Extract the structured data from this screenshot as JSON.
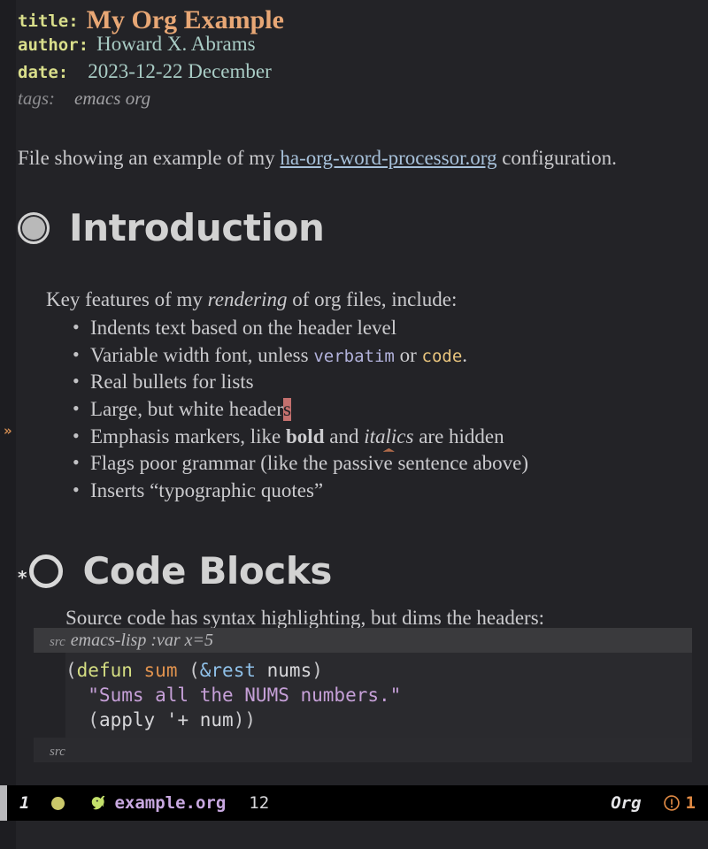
{
  "buffer": {
    "keywords": [
      {
        "key": "title:",
        "value": "My Org Example"
      },
      {
        "key": "author:",
        "value": "Howard X. Abrams"
      },
      {
        "key": "date:",
        "value": "2023-12-22 December"
      },
      {
        "key": "tags:",
        "value": "emacs org"
      }
    ],
    "intro": {
      "before": "File showing an example of my ",
      "link": "ha-org-word-processor.org",
      "after": " configuration."
    },
    "sections": [
      {
        "heading": "Introduction",
        "bullet_icon": "filled-ring-bullet",
        "lead": {
          "before": "Key features of my ",
          "italic": "rendering",
          "after": " of org files, include:"
        },
        "items": [
          {
            "text": "Indents text based on the header level"
          },
          {
            "text": "Variable width font, unless verbatim or code.",
            "parts": [
              {
                "t": "Variable width font, unless ",
                "style": "plain"
              },
              {
                "t": "verbatim",
                "style": "verbatim"
              },
              {
                "t": " or ",
                "style": "plain"
              },
              {
                "t": "code",
                "style": "code"
              },
              {
                "t": ".",
                "style": "plain"
              }
            ]
          },
          {
            "text": "Real bullets for lists"
          },
          {
            "text": "Large, but white headers",
            "parts": [
              {
                "t": "Large, but white header",
                "style": "plain"
              },
              {
                "t": "s",
                "style": "cursor"
              }
            ]
          },
          {
            "text": "Emphasis markers, like bold and italics are hidden",
            "parts": [
              {
                "t": "Emphasis markers, like ",
                "style": "plain"
              },
              {
                "t": "bold",
                "style": "bold"
              },
              {
                "t": " and ",
                "style": "plain"
              },
              {
                "t": "italics",
                "style": "italic-flagged"
              },
              {
                "t": " are hidden",
                "style": "plain"
              }
            ]
          },
          {
            "text": "Flags poor grammar (like the passive sentence above)"
          },
          {
            "text": "Inserts “typographic quotes”"
          }
        ]
      },
      {
        "heading": "Code Blocks",
        "bullet_icon": "hollow-ring-bullet",
        "star": "*",
        "lead": {
          "before": "Source code has syntax highlighting, but dims the headers:",
          "italic": "",
          "after": ""
        },
        "src": {
          "head_kw": "src",
          "head_args": "emacs-lisp :var x=5",
          "foot_kw": "src",
          "lines": [
            [
              {
                "t": "(",
                "c": "paren"
              },
              {
                "t": "defun",
                "c": "defun"
              },
              {
                "t": " ",
                "c": "plain"
              },
              {
                "t": "sum",
                "c": "fname"
              },
              {
                "t": " (",
                "c": "paren"
              },
              {
                "t": "&rest",
                "c": "amp"
              },
              {
                "t": " ",
                "c": "plain"
              },
              {
                "t": "nums",
                "c": "var"
              },
              {
                "t": ")",
                "c": "paren"
              }
            ],
            [
              {
                "t": "  \"Sums all the NUMS numbers.\"",
                "c": "string"
              }
            ],
            [
              {
                "t": "  (",
                "c": "paren"
              },
              {
                "t": "apply",
                "c": "var"
              },
              {
                "t": " ",
                "c": "plain"
              },
              {
                "t": "'+",
                "c": "var"
              },
              {
                "t": " ",
                "c": "plain"
              },
              {
                "t": "num",
                "c": "var"
              },
              {
                "t": "))",
                "c": "paren"
              }
            ]
          ]
        }
      }
    ],
    "fringe_marker": "»"
  },
  "modeline": {
    "window_number": "1",
    "status_dot_color": "#cbc86a",
    "gnu_icon": "gnu-icon",
    "file_name": "example.org",
    "position": "12",
    "major_mode": "Org",
    "warning_icon": "warning-circle-icon",
    "warning_count": "1"
  }
}
